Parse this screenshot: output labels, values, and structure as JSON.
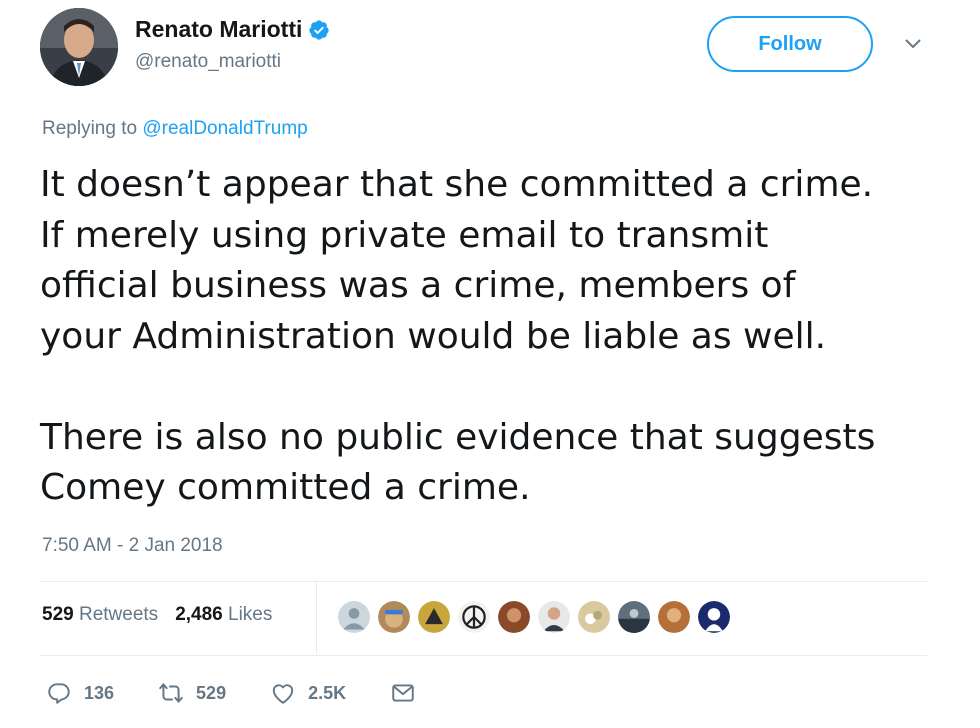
{
  "author": {
    "display_name": "Renato Mariotti",
    "handle": "@renato_mariotti",
    "verified": true
  },
  "follow_label": "Follow",
  "reply_context": {
    "prefix": "Replying to ",
    "target": "@realDonaldTrump"
  },
  "tweet": {
    "text": "It doesn’t appear that she committed a crime.\nIf merely using private email to transmit\nofficial business was a crime, members of\nyour Administration would be liable as well.\n\nThere is also no public evidence that suggests\nComey committed a crime.",
    "timestamp": "7:50 AM - 2 Jan 2018"
  },
  "stats": {
    "retweets_count": "529",
    "retweets_label": "Retweets",
    "likes_count": "2,486",
    "likes_label": "Likes"
  },
  "actions": {
    "replies": "136",
    "retweets": "529",
    "likes": "2.5K"
  },
  "colors": {
    "accent": "#1da1f2",
    "muted": "#657786",
    "text": "#14171a"
  },
  "icons": [
    "verified-badge-icon",
    "chevron-down-icon",
    "reply-icon",
    "retweet-icon",
    "like-icon",
    "message-icon"
  ]
}
